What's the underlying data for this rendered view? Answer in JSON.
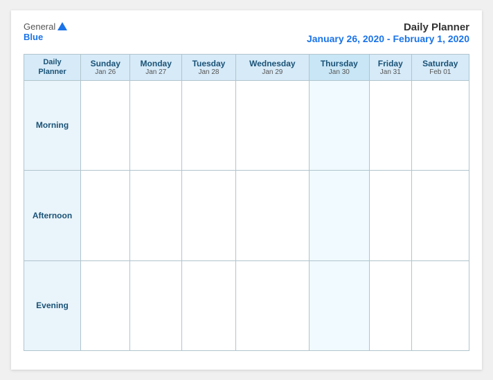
{
  "header": {
    "logo_general": "General",
    "logo_blue": "Blue",
    "title": "Daily Planner",
    "date_range": "January 26, 2020 - February 1, 2020"
  },
  "table": {
    "header_col": "Daily\nPlanner",
    "days": [
      {
        "name": "Sunday",
        "date": "Jan 26"
      },
      {
        "name": "Monday",
        "date": "Jan 27"
      },
      {
        "name": "Tuesday",
        "date": "Jan 28"
      },
      {
        "name": "Wednesday",
        "date": "Jan 29"
      },
      {
        "name": "Thursday",
        "date": "Jan 30"
      },
      {
        "name": "Friday",
        "date": "Jan 31"
      },
      {
        "name": "Saturday",
        "date": "Feb 01"
      }
    ],
    "rows": [
      {
        "label": "Morning"
      },
      {
        "label": "Afternoon"
      },
      {
        "label": "Evening"
      }
    ]
  }
}
